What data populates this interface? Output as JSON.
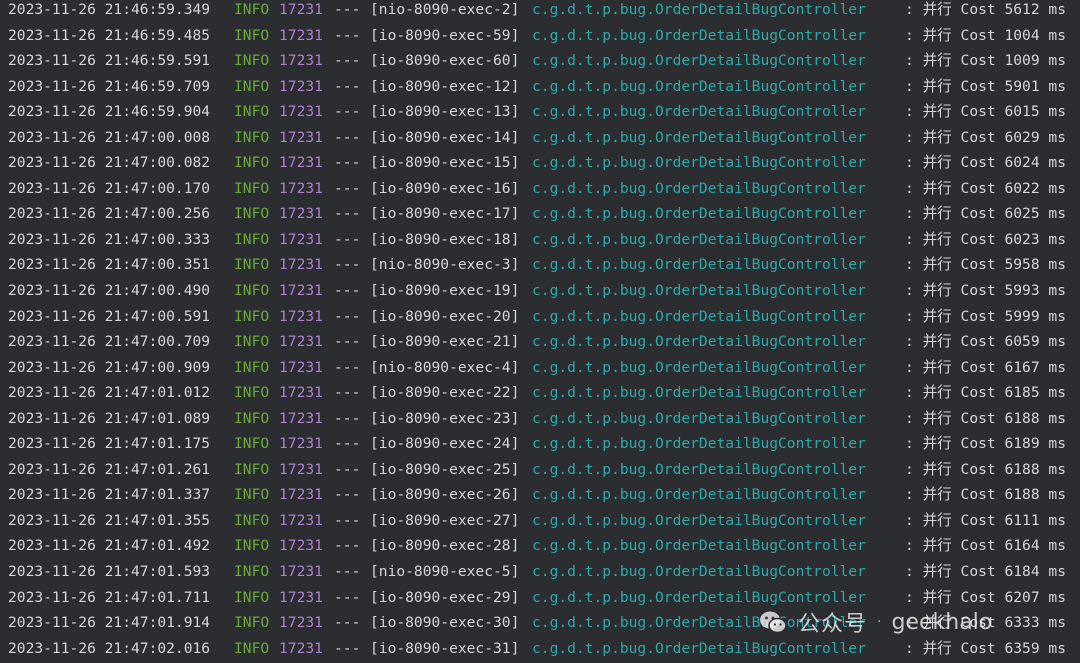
{
  "log": {
    "level_color": "#6aab3a",
    "pid_color": "#b07fd1",
    "logger_color": "#2ea9a9",
    "text_color": "#d4d6da",
    "background": "#2b2d30",
    "rows": [
      {
        "timestamp": "2023-11-26 21:46:59.349",
        "level": "INFO",
        "pid": "17231",
        "sep": "---",
        "thread": "[nio-8090-exec-2]",
        "logger": "c.g.d.t.p.bug.OrderDetailBugController",
        "message": ": 并行 Cost 5612 ms"
      },
      {
        "timestamp": "2023-11-26 21:46:59.485",
        "level": "INFO",
        "pid": "17231",
        "sep": "---",
        "thread": "[io-8090-exec-59]",
        "logger": "c.g.d.t.p.bug.OrderDetailBugController",
        "message": ": 并行 Cost 1004 ms"
      },
      {
        "timestamp": "2023-11-26 21:46:59.591",
        "level": "INFO",
        "pid": "17231",
        "sep": "---",
        "thread": "[io-8090-exec-60]",
        "logger": "c.g.d.t.p.bug.OrderDetailBugController",
        "message": ": 并行 Cost 1009 ms"
      },
      {
        "timestamp": "2023-11-26 21:46:59.709",
        "level": "INFO",
        "pid": "17231",
        "sep": "---",
        "thread": "[io-8090-exec-12]",
        "logger": "c.g.d.t.p.bug.OrderDetailBugController",
        "message": ": 并行 Cost 5901 ms"
      },
      {
        "timestamp": "2023-11-26 21:46:59.904",
        "level": "INFO",
        "pid": "17231",
        "sep": "---",
        "thread": "[io-8090-exec-13]",
        "logger": "c.g.d.t.p.bug.OrderDetailBugController",
        "message": ": 并行 Cost 6015 ms"
      },
      {
        "timestamp": "2023-11-26 21:47:00.008",
        "level": "INFO",
        "pid": "17231",
        "sep": "---",
        "thread": "[io-8090-exec-14]",
        "logger": "c.g.d.t.p.bug.OrderDetailBugController",
        "message": ": 并行 Cost 6029 ms"
      },
      {
        "timestamp": "2023-11-26 21:47:00.082",
        "level": "INFO",
        "pid": "17231",
        "sep": "---",
        "thread": "[io-8090-exec-15]",
        "logger": "c.g.d.t.p.bug.OrderDetailBugController",
        "message": ": 并行 Cost 6024 ms"
      },
      {
        "timestamp": "2023-11-26 21:47:00.170",
        "level": "INFO",
        "pid": "17231",
        "sep": "---",
        "thread": "[io-8090-exec-16]",
        "logger": "c.g.d.t.p.bug.OrderDetailBugController",
        "message": ": 并行 Cost 6022 ms"
      },
      {
        "timestamp": "2023-11-26 21:47:00.256",
        "level": "INFO",
        "pid": "17231",
        "sep": "---",
        "thread": "[io-8090-exec-17]",
        "logger": "c.g.d.t.p.bug.OrderDetailBugController",
        "message": ": 并行 Cost 6025 ms"
      },
      {
        "timestamp": "2023-11-26 21:47:00.333",
        "level": "INFO",
        "pid": "17231",
        "sep": "---",
        "thread": "[io-8090-exec-18]",
        "logger": "c.g.d.t.p.bug.OrderDetailBugController",
        "message": ": 并行 Cost 6023 ms"
      },
      {
        "timestamp": "2023-11-26 21:47:00.351",
        "level": "INFO",
        "pid": "17231",
        "sep": "---",
        "thread": "[nio-8090-exec-3]",
        "logger": "c.g.d.t.p.bug.OrderDetailBugController",
        "message": ": 并行 Cost 5958 ms"
      },
      {
        "timestamp": "2023-11-26 21:47:00.490",
        "level": "INFO",
        "pid": "17231",
        "sep": "---",
        "thread": "[io-8090-exec-19]",
        "logger": "c.g.d.t.p.bug.OrderDetailBugController",
        "message": ": 并行 Cost 5993 ms"
      },
      {
        "timestamp": "2023-11-26 21:47:00.591",
        "level": "INFO",
        "pid": "17231",
        "sep": "---",
        "thread": "[io-8090-exec-20]",
        "logger": "c.g.d.t.p.bug.OrderDetailBugController",
        "message": ": 并行 Cost 5999 ms"
      },
      {
        "timestamp": "2023-11-26 21:47:00.709",
        "level": "INFO",
        "pid": "17231",
        "sep": "---",
        "thread": "[io-8090-exec-21]",
        "logger": "c.g.d.t.p.bug.OrderDetailBugController",
        "message": ": 并行 Cost 6059 ms"
      },
      {
        "timestamp": "2023-11-26 21:47:00.909",
        "level": "INFO",
        "pid": "17231",
        "sep": "---",
        "thread": "[nio-8090-exec-4]",
        "logger": "c.g.d.t.p.bug.OrderDetailBugController",
        "message": ": 并行 Cost 6167 ms"
      },
      {
        "timestamp": "2023-11-26 21:47:01.012",
        "level": "INFO",
        "pid": "17231",
        "sep": "---",
        "thread": "[io-8090-exec-22]",
        "logger": "c.g.d.t.p.bug.OrderDetailBugController",
        "message": ": 并行 Cost 6185 ms"
      },
      {
        "timestamp": "2023-11-26 21:47:01.089",
        "level": "INFO",
        "pid": "17231",
        "sep": "---",
        "thread": "[io-8090-exec-23]",
        "logger": "c.g.d.t.p.bug.OrderDetailBugController",
        "message": ": 并行 Cost 6188 ms"
      },
      {
        "timestamp": "2023-11-26 21:47:01.175",
        "level": "INFO",
        "pid": "17231",
        "sep": "---",
        "thread": "[io-8090-exec-24]",
        "logger": "c.g.d.t.p.bug.OrderDetailBugController",
        "message": ": 并行 Cost 6189 ms"
      },
      {
        "timestamp": "2023-11-26 21:47:01.261",
        "level": "INFO",
        "pid": "17231",
        "sep": "---",
        "thread": "[io-8090-exec-25]",
        "logger": "c.g.d.t.p.bug.OrderDetailBugController",
        "message": ": 并行 Cost 6188 ms"
      },
      {
        "timestamp": "2023-11-26 21:47:01.337",
        "level": "INFO",
        "pid": "17231",
        "sep": "---",
        "thread": "[io-8090-exec-26]",
        "logger": "c.g.d.t.p.bug.OrderDetailBugController",
        "message": ": 并行 Cost 6188 ms"
      },
      {
        "timestamp": "2023-11-26 21:47:01.355",
        "level": "INFO",
        "pid": "17231",
        "sep": "---",
        "thread": "[io-8090-exec-27]",
        "logger": "c.g.d.t.p.bug.OrderDetailBugController",
        "message": ": 并行 Cost 6111 ms"
      },
      {
        "timestamp": "2023-11-26 21:47:01.492",
        "level": "INFO",
        "pid": "17231",
        "sep": "---",
        "thread": "[io-8090-exec-28]",
        "logger": "c.g.d.t.p.bug.OrderDetailBugController",
        "message": ": 并行 Cost 6164 ms"
      },
      {
        "timestamp": "2023-11-26 21:47:01.593",
        "level": "INFO",
        "pid": "17231",
        "sep": "---",
        "thread": "[nio-8090-exec-5]",
        "logger": "c.g.d.t.p.bug.OrderDetailBugController",
        "message": ": 并行 Cost 6184 ms"
      },
      {
        "timestamp": "2023-11-26 21:47:01.711",
        "level": "INFO",
        "pid": "17231",
        "sep": "---",
        "thread": "[io-8090-exec-29]",
        "logger": "c.g.d.t.p.bug.OrderDetailBugController",
        "message": ": 并行 Cost 6207 ms"
      },
      {
        "timestamp": "2023-11-26 21:47:01.914",
        "level": "INFO",
        "pid": "17231",
        "sep": "---",
        "thread": "[io-8090-exec-30]",
        "logger": "c.g.d.t.p.bug.OrderDetailBugController",
        "message": ": 并行 Cost 6333 ms"
      },
      {
        "timestamp": "2023-11-26 21:47:02.016",
        "level": "INFO",
        "pid": "17231",
        "sep": "---",
        "thread": "[io-8090-exec-31]",
        "logger": "c.g.d.t.p.bug.OrderDetailBugController",
        "message": ": 并行 Cost 6359 ms"
      }
    ]
  },
  "watermark": {
    "icon": "wechat-icon",
    "text": "公众号",
    "dot": "·",
    "handle": "geekhalo"
  }
}
